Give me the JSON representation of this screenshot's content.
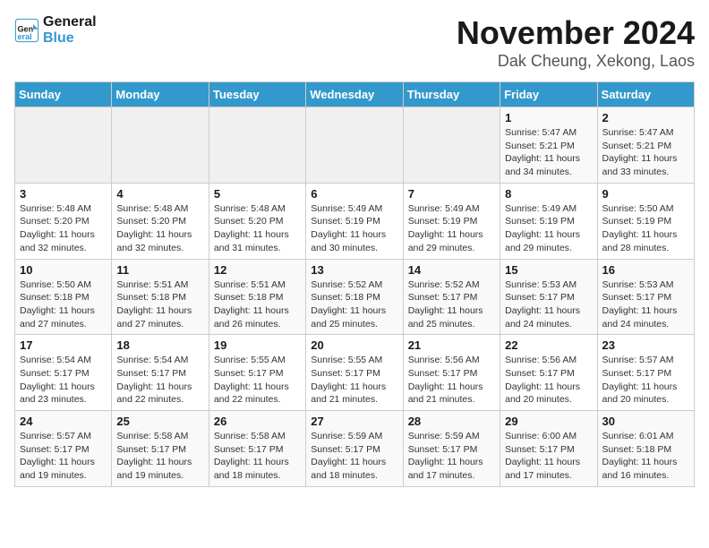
{
  "header": {
    "logo_line1": "General",
    "logo_line2": "Blue",
    "month": "November 2024",
    "location": "Dak Cheung, Xekong, Laos"
  },
  "days_of_week": [
    "Sunday",
    "Monday",
    "Tuesday",
    "Wednesday",
    "Thursday",
    "Friday",
    "Saturday"
  ],
  "weeks": [
    [
      {
        "day": "",
        "info": ""
      },
      {
        "day": "",
        "info": ""
      },
      {
        "day": "",
        "info": ""
      },
      {
        "day": "",
        "info": ""
      },
      {
        "day": "",
        "info": ""
      },
      {
        "day": "1",
        "info": "Sunrise: 5:47 AM\nSunset: 5:21 PM\nDaylight: 11 hours and 34 minutes."
      },
      {
        "day": "2",
        "info": "Sunrise: 5:47 AM\nSunset: 5:21 PM\nDaylight: 11 hours and 33 minutes."
      }
    ],
    [
      {
        "day": "3",
        "info": "Sunrise: 5:48 AM\nSunset: 5:20 PM\nDaylight: 11 hours and 32 minutes."
      },
      {
        "day": "4",
        "info": "Sunrise: 5:48 AM\nSunset: 5:20 PM\nDaylight: 11 hours and 32 minutes."
      },
      {
        "day": "5",
        "info": "Sunrise: 5:48 AM\nSunset: 5:20 PM\nDaylight: 11 hours and 31 minutes."
      },
      {
        "day": "6",
        "info": "Sunrise: 5:49 AM\nSunset: 5:19 PM\nDaylight: 11 hours and 30 minutes."
      },
      {
        "day": "7",
        "info": "Sunrise: 5:49 AM\nSunset: 5:19 PM\nDaylight: 11 hours and 29 minutes."
      },
      {
        "day": "8",
        "info": "Sunrise: 5:49 AM\nSunset: 5:19 PM\nDaylight: 11 hours and 29 minutes."
      },
      {
        "day": "9",
        "info": "Sunrise: 5:50 AM\nSunset: 5:19 PM\nDaylight: 11 hours and 28 minutes."
      }
    ],
    [
      {
        "day": "10",
        "info": "Sunrise: 5:50 AM\nSunset: 5:18 PM\nDaylight: 11 hours and 27 minutes."
      },
      {
        "day": "11",
        "info": "Sunrise: 5:51 AM\nSunset: 5:18 PM\nDaylight: 11 hours and 27 minutes."
      },
      {
        "day": "12",
        "info": "Sunrise: 5:51 AM\nSunset: 5:18 PM\nDaylight: 11 hours and 26 minutes."
      },
      {
        "day": "13",
        "info": "Sunrise: 5:52 AM\nSunset: 5:18 PM\nDaylight: 11 hours and 25 minutes."
      },
      {
        "day": "14",
        "info": "Sunrise: 5:52 AM\nSunset: 5:17 PM\nDaylight: 11 hours and 25 minutes."
      },
      {
        "day": "15",
        "info": "Sunrise: 5:53 AM\nSunset: 5:17 PM\nDaylight: 11 hours and 24 minutes."
      },
      {
        "day": "16",
        "info": "Sunrise: 5:53 AM\nSunset: 5:17 PM\nDaylight: 11 hours and 24 minutes."
      }
    ],
    [
      {
        "day": "17",
        "info": "Sunrise: 5:54 AM\nSunset: 5:17 PM\nDaylight: 11 hours and 23 minutes."
      },
      {
        "day": "18",
        "info": "Sunrise: 5:54 AM\nSunset: 5:17 PM\nDaylight: 11 hours and 22 minutes."
      },
      {
        "day": "19",
        "info": "Sunrise: 5:55 AM\nSunset: 5:17 PM\nDaylight: 11 hours and 22 minutes."
      },
      {
        "day": "20",
        "info": "Sunrise: 5:55 AM\nSunset: 5:17 PM\nDaylight: 11 hours and 21 minutes."
      },
      {
        "day": "21",
        "info": "Sunrise: 5:56 AM\nSunset: 5:17 PM\nDaylight: 11 hours and 21 minutes."
      },
      {
        "day": "22",
        "info": "Sunrise: 5:56 AM\nSunset: 5:17 PM\nDaylight: 11 hours and 20 minutes."
      },
      {
        "day": "23",
        "info": "Sunrise: 5:57 AM\nSunset: 5:17 PM\nDaylight: 11 hours and 20 minutes."
      }
    ],
    [
      {
        "day": "24",
        "info": "Sunrise: 5:57 AM\nSunset: 5:17 PM\nDaylight: 11 hours and 19 minutes."
      },
      {
        "day": "25",
        "info": "Sunrise: 5:58 AM\nSunset: 5:17 PM\nDaylight: 11 hours and 19 minutes."
      },
      {
        "day": "26",
        "info": "Sunrise: 5:58 AM\nSunset: 5:17 PM\nDaylight: 11 hours and 18 minutes."
      },
      {
        "day": "27",
        "info": "Sunrise: 5:59 AM\nSunset: 5:17 PM\nDaylight: 11 hours and 18 minutes."
      },
      {
        "day": "28",
        "info": "Sunrise: 5:59 AM\nSunset: 5:17 PM\nDaylight: 11 hours and 17 minutes."
      },
      {
        "day": "29",
        "info": "Sunrise: 6:00 AM\nSunset: 5:17 PM\nDaylight: 11 hours and 17 minutes."
      },
      {
        "day": "30",
        "info": "Sunrise: 6:01 AM\nSunset: 5:18 PM\nDaylight: 11 hours and 16 minutes."
      }
    ]
  ]
}
